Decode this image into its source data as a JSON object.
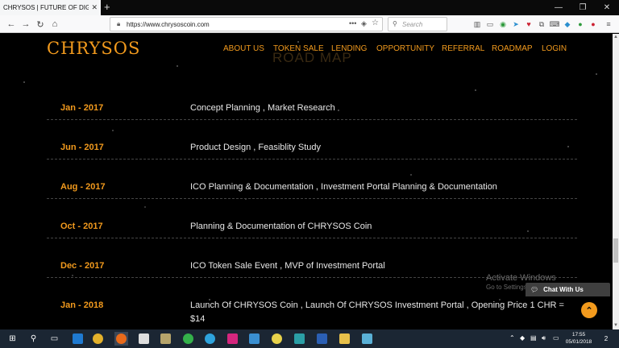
{
  "browser": {
    "tab_title": "CHRYSOS | FUTURE OF DIGITAL FIN",
    "url": "https://www.chrysoscoin.com",
    "search_placeholder": "Search"
  },
  "site": {
    "logo": "CHRYSOS",
    "nav": [
      "ABOUT US",
      "TOKEN SALE",
      "LENDING",
      "OPPORTUNITY",
      "REFERRAL",
      "ROADMAP",
      "LOGIN"
    ],
    "section_watermark": "ROAD MAP"
  },
  "roadmap": [
    {
      "date": "Jan - 2017",
      "desc": "Concept Planning , Market Research"
    },
    {
      "date": "Jun - 2017",
      "desc": "Product Design , Feasiblity Study"
    },
    {
      "date": "Aug - 2017",
      "desc": "ICO Planning & Documentation , Investment Portal Planning & Documentation"
    },
    {
      "date": "Oct - 2017",
      "desc": "Planning & Documentation of CHRYSOS Coin"
    },
    {
      "date": "Dec - 2017",
      "desc": "ICO Token Sale Event , MVP of Investment Portal"
    },
    {
      "date": "Jan - 2018",
      "desc": "Launch Of CHRYSOS Coin , Launch Of CHRYSOS Investment Portal , Opening Price 1 CHR = $14"
    }
  ],
  "overlay": {
    "activate_line1": "Activate Windows",
    "activate_line2": "Go to Settings to activate Wind",
    "chat_label": "Chat With Us"
  },
  "taskbar": {
    "time": "17:55",
    "date": "05/01/2018",
    "notification_count": "2"
  },
  "colors": {
    "accent": "#f29a1d",
    "background": "#000000",
    "taskbar": "#1b2633"
  }
}
